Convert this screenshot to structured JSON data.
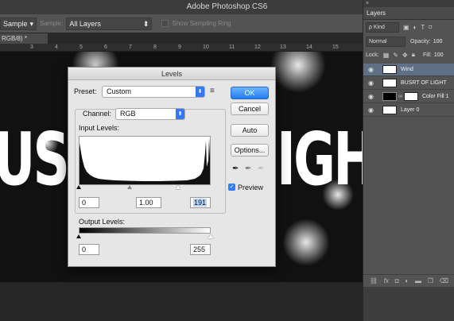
{
  "app": {
    "title": "Adobe Photoshop CS6"
  },
  "options_bar": {
    "sample_size": "Sample",
    "sample_label": "Sample:",
    "sample_value": "All Layers",
    "show_ring": "Show Sampling Ring"
  },
  "document": {
    "tab_label": "RGB/8) *",
    "ruler_ticks": [
      "3",
      "4",
      "5",
      "6",
      "7",
      "8",
      "9",
      "10",
      "11",
      "12",
      "13",
      "14",
      "15"
    ],
    "canvas_text_left": "US",
    "canvas_text_right": "IGH"
  },
  "levels_dialog": {
    "title": "Levels",
    "preset_label": "Preset:",
    "preset_value": "Custom",
    "channel_label": "Channel:",
    "channel_value": "RGB",
    "input_levels_label": "Input Levels:",
    "input_black": "0",
    "input_gamma": "1.00",
    "input_white": "191",
    "output_levels_label": "Output Levels:",
    "output_black": "0",
    "output_white": "255",
    "ok_label": "OK",
    "cancel_label": "Cancel",
    "auto_label": "Auto",
    "options_label": "Options...",
    "preview_label": "Preview",
    "preview_checked": true
  },
  "layers_panel": {
    "close_glyph": "×",
    "tab_label": "Layers",
    "filter_kind": "ρ Kind",
    "blend_mode": "Normal",
    "opacity_label": "Opacity:",
    "opacity_value": "100",
    "lock_label": "Lock:",
    "fill_label": "Fill:",
    "fill_value": "100",
    "layers": [
      {
        "name": "Wind",
        "active": true
      },
      {
        "name": "BUSRT OF LIGHT",
        "active": false
      },
      {
        "name": "Color Fill 1",
        "active": false
      },
      {
        "name": "Layer 0",
        "active": false
      }
    ]
  },
  "colors": {
    "accent_blue": "#1d7cf2",
    "active_layer": "#5f6f85",
    "panel_bg": "#535353"
  }
}
